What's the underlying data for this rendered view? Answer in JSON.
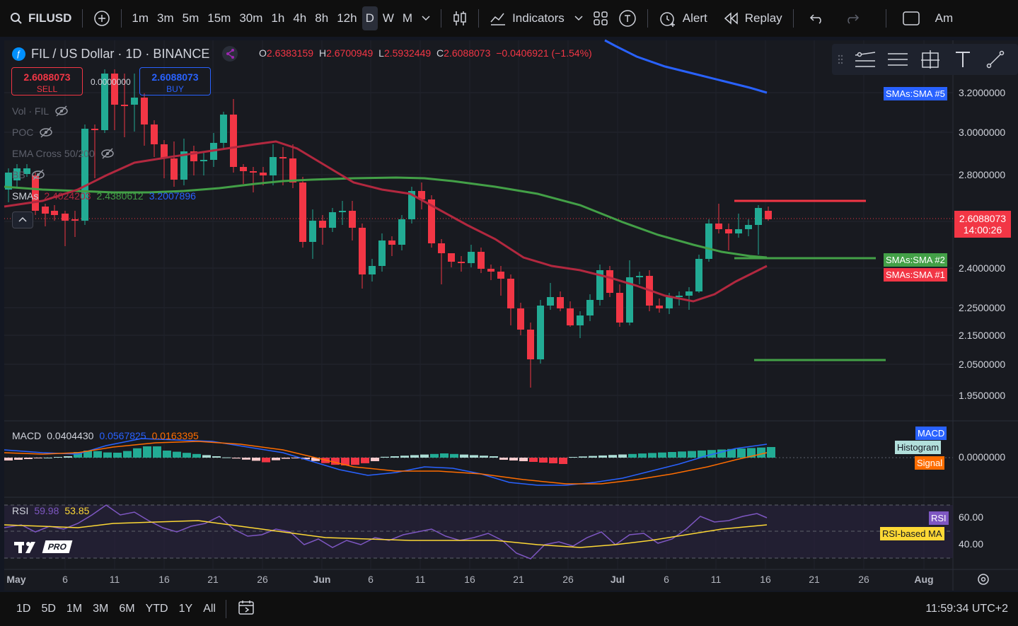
{
  "topbar": {
    "symbol": "FILUSD",
    "timeframes": [
      "1m",
      "3m",
      "5m",
      "15m",
      "30m",
      "1h",
      "4h",
      "8h",
      "12h",
      "D",
      "W",
      "M"
    ],
    "active_timeframe": "D",
    "indicators_label": "Indicators",
    "alert_label": "Alert",
    "replay_label": "Replay",
    "account_label": "Am"
  },
  "legend": {
    "title": "FIL / US Dollar · 1D · BINANCE",
    "o_key": "O",
    "o_val": "2.6383159",
    "h_key": "H",
    "h_val": "2.6700949",
    "l_key": "L",
    "l_val": "2.5932449",
    "c_key": "C",
    "c_val": "2.6088073",
    "change": "−0.0406921 (−1.54%)"
  },
  "trade": {
    "sell_price": "2.6088073",
    "sell_label": "SELL",
    "spread": "0.0000000",
    "buy_price": "2.6088073",
    "buy_label": "BUY"
  },
  "indicators_list": [
    {
      "name": "Vol · FIL"
    },
    {
      "name": "POC"
    },
    {
      "name": "EMA Cross 50/200"
    },
    {
      "name": "BB"
    }
  ],
  "smas": {
    "label": "SMAs",
    "v1": "2.4024203",
    "v2": "2.4380612",
    "v3": "3.2007896"
  },
  "macd": {
    "label": "MACD",
    "v1": "0.0404430",
    "v2": "0.0567825",
    "v3": "0.0163395"
  },
  "rsi": {
    "label": "RSI",
    "v1": "59.98",
    "v2": "53.85"
  },
  "price_scale": {
    "labels": [
      "3.2000000",
      "3.0000000",
      "2.8000000",
      "2.4000000",
      "2.2500000",
      "2.1500000",
      "2.0500000",
      "1.9500000"
    ],
    "current_price": "2.6088073",
    "countdown": "14:00:26",
    "macd_zero": "0.0000000",
    "rsi_60": "60.00",
    "rsi_40": "40.00"
  },
  "tags": {
    "sma5": "SMAs:SMA #5",
    "sma2": "SMAs:SMA #2",
    "sma1": "SMAs:SMA #1",
    "macd": "MACD",
    "histogram": "Histogram",
    "signal": "Signal",
    "rsi": "RSI",
    "rsi_ma": "RSI-based MA"
  },
  "time_axis": [
    "May",
    "6",
    "11",
    "16",
    "21",
    "26",
    "Jun",
    "6",
    "11",
    "16",
    "21",
    "26",
    "Jul",
    "6",
    "11",
    "16",
    "21",
    "26",
    "Aug"
  ],
  "bottombar": {
    "ranges": [
      "1D",
      "5D",
      "1M",
      "3M",
      "6M",
      "YTD",
      "1Y",
      "All"
    ],
    "clock": "11:59:34 UTC+2"
  },
  "logo_text": "PRO",
  "colors": {
    "up": "#22ab94",
    "down": "#f23645",
    "sma5": "#2962ff",
    "sma2": "#43a047",
    "sma1": "#b2283f",
    "macd": "#2962ff",
    "signal": "#ff6d00",
    "rsi": "#7e57c2",
    "rsi_ma": "#fdd835"
  }
}
